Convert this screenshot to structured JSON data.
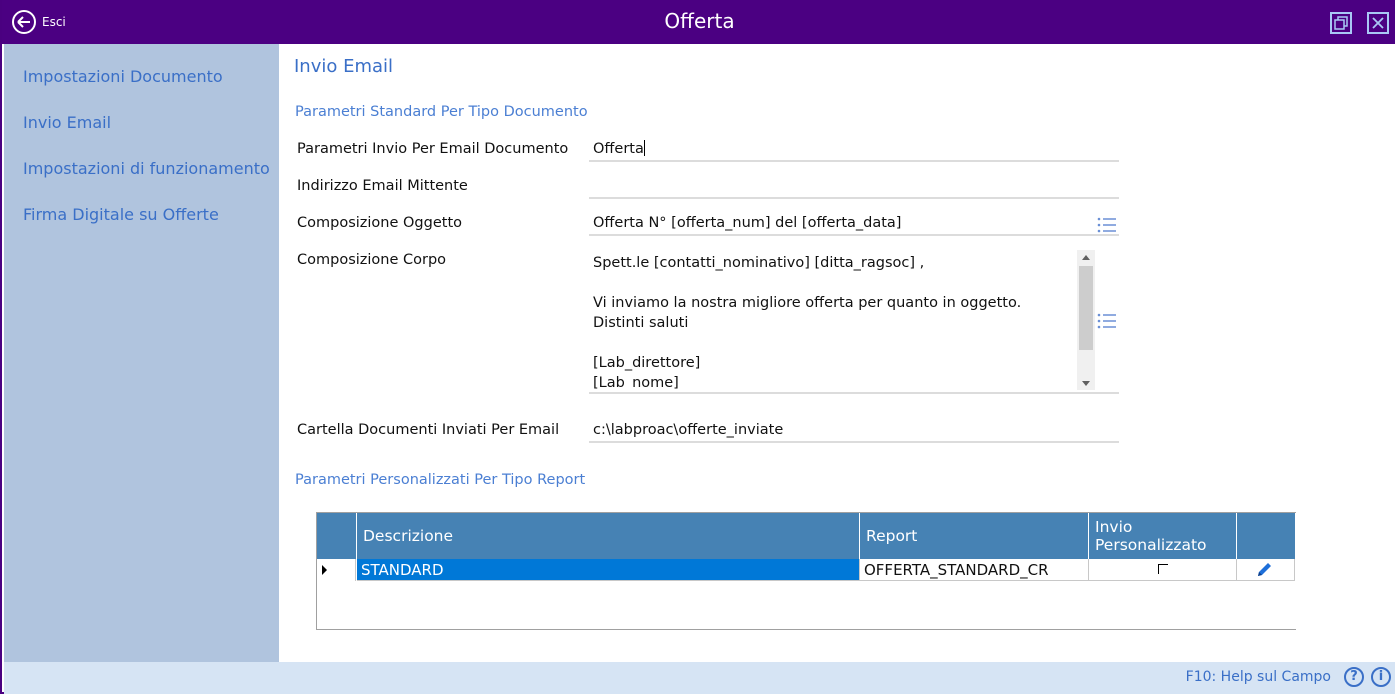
{
  "window": {
    "back_label": "Esci",
    "title": "Offerta"
  },
  "sidebar": {
    "items": [
      {
        "label": "Impostazioni Documento"
      },
      {
        "label": "Invio Email"
      },
      {
        "label": "Impostazioni di funzionamento"
      },
      {
        "label": "Firma Digitale su Offerte"
      }
    ]
  },
  "main": {
    "section_title": "Invio Email",
    "standard_group_title": "Parametri Standard Per Tipo Documento",
    "fields": {
      "params_label": "Parametri Invio Per Email Documento",
      "params_value": "Offerta",
      "sender_label": "Indirizzo Email Mittente",
      "sender_value": "",
      "subject_label": "Composizione Oggetto",
      "subject_value": "Offerta N° [offerta_num] del [offerta_data]",
      "body_label": "Composizione Corpo",
      "body_value": "Spett.le [contatti_nominativo] [ditta_ragsoc] ,\n\nVi inviamo la nostra migliore offerta per quanto in oggetto.\nDistinti saluti\n\n[Lab_direttore]\n[Lab_nome]",
      "folder_label": "Cartella Documenti Inviati Per Email",
      "folder_value": "c:\\labproac\\offerte_inviate"
    },
    "custom_group_title": "Parametri Personalizzati Per Tipo Report",
    "grid": {
      "columns": [
        "Descrizione",
        "Report",
        "Invio Personalizzato"
      ],
      "rows": [
        {
          "descrizione": "STANDARD",
          "report": "OFFERTA_STANDARD_CR",
          "invio_personalizzato": false
        }
      ]
    }
  },
  "statusbar": {
    "help_text": "F10: Help sul Campo"
  },
  "colors": {
    "titlebar": "#4b0082",
    "sidebar": "#b0c4de",
    "accent": "#3a6fc7",
    "grid_header": "#4682b4",
    "selection": "#0078d7"
  }
}
